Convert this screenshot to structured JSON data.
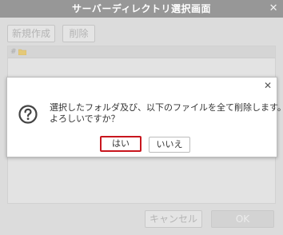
{
  "window": {
    "title": "サーバーディレクトリ選択画面",
    "close_label": "✕"
  },
  "toolbar": {
    "new_label": "新規作成",
    "delete_label": "削除"
  },
  "tree": {
    "root_label": "#"
  },
  "footer": {
    "cancel_label": "キャンセル",
    "ok_label": "OK"
  },
  "confirm": {
    "close_label": "✕",
    "message_line1": "選択したフォルダ及び、以下のファイルを全て削除します。",
    "message_line2": "よろしいですか？",
    "yes_label": "はい",
    "no_label": "いいえ"
  },
  "colors": {
    "titlebar": "#979797",
    "highlight": "#c8161e",
    "folder": "#f3c94f"
  },
  "icons": {
    "folder": "folder-icon",
    "question": "question-icon",
    "close": "close-icon"
  }
}
